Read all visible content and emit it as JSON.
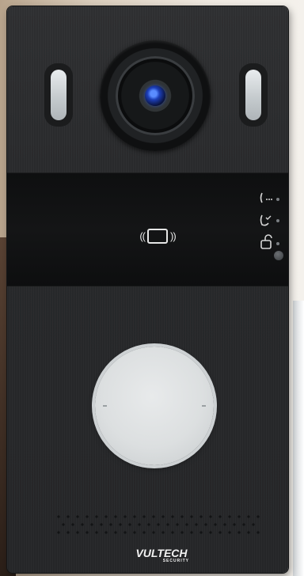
{
  "scene": "video-intercom-door-station",
  "panel": {
    "color": "#27282a",
    "ir_lights": 2,
    "camera": {
      "lens_color": "#1d3fb8"
    },
    "card_reader": {
      "icon": "rfid-card-icon"
    },
    "status_indicators": [
      {
        "name": "call-in-progress-icon"
      },
      {
        "name": "call-answered-icon"
      },
      {
        "name": "door-unlocked-icon"
      },
      {
        "name": "status-led"
      }
    ],
    "call_button": {
      "color": "#dcdfe0"
    },
    "brand": {
      "name": "VULTECH",
      "sub": "SECURITY"
    }
  }
}
